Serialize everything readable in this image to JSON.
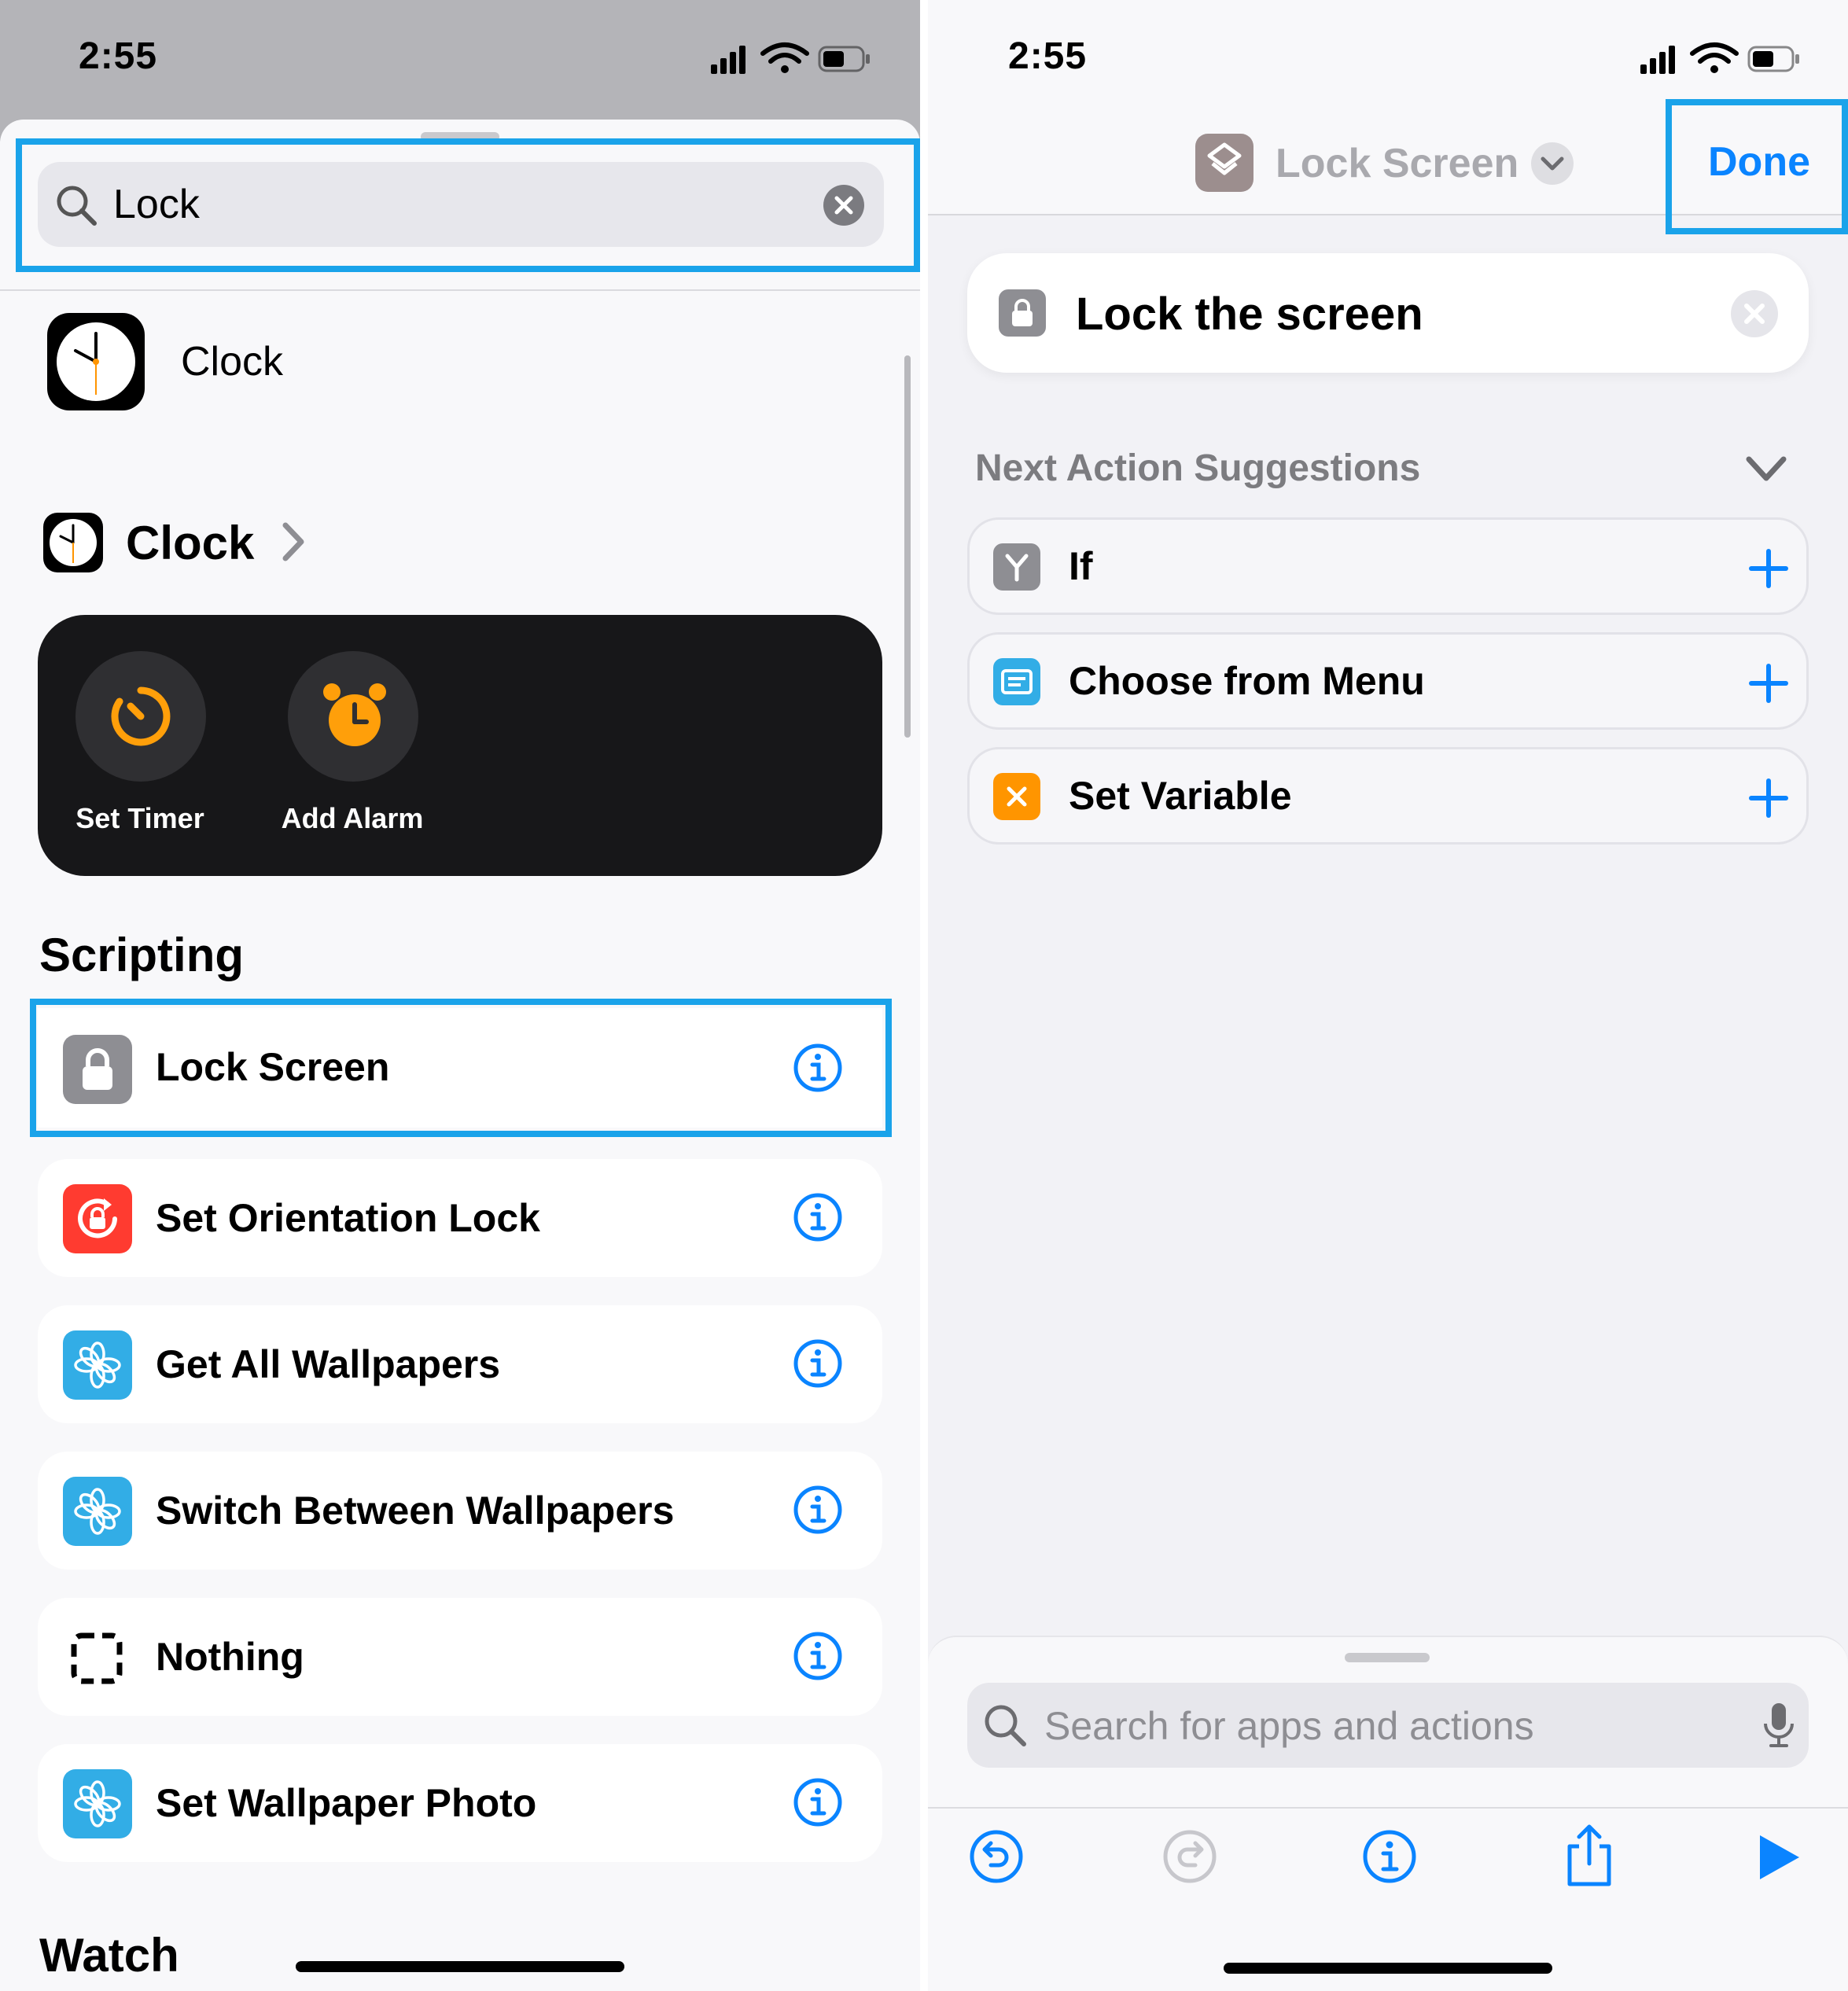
{
  "left": {
    "status_time": "2:55",
    "search": {
      "value": "Lock"
    },
    "top_result": {
      "label": "Clock"
    },
    "app_section": {
      "title": "Clock"
    },
    "quick_actions": [
      {
        "label": "Set Timer",
        "icon": "timer-icon",
        "color": "#ff9f0a"
      },
      {
        "label": "Add Alarm",
        "icon": "alarm-clock-icon",
        "color": "#ff9f0a"
      }
    ],
    "section_scripting": "Scripting",
    "actions": [
      {
        "label": "Lock Screen",
        "icon": "lock-icon",
        "color": "#8e8e93"
      },
      {
        "label": "Set Orientation Lock",
        "icon": "orientation-lock-icon",
        "color": "#ff3b30"
      },
      {
        "label": "Get All Wallpapers",
        "icon": "wallpaper-flower-icon",
        "color": "#32ade6"
      },
      {
        "label": "Switch Between Wallpapers",
        "icon": "wallpaper-flower-icon",
        "color": "#32ade6"
      },
      {
        "label": "Nothing",
        "icon": "dashed-square-icon",
        "color": "#000000"
      },
      {
        "label": "Set Wallpaper Photo",
        "icon": "wallpaper-flower-icon",
        "color": "#32ade6"
      }
    ],
    "section_watch": "Watch"
  },
  "right": {
    "status_time": "2:55",
    "shortcut_title": "Lock Screen",
    "done_label": "Done",
    "action_card": {
      "label": "Lock the screen",
      "icon": "lock-icon"
    },
    "suggestions_title": "Next Action Suggestions",
    "suggestions": [
      {
        "label": "If",
        "icon": "branch-icon",
        "color": "#8e8e93"
      },
      {
        "label": "Choose from Menu",
        "icon": "menu-icon",
        "color": "#32ade6"
      },
      {
        "label": "Set Variable",
        "icon": "variable-icon",
        "color": "#ff9500"
      }
    ],
    "search_placeholder": "Search for apps and actions"
  },
  "colors": {
    "accent": "#0a84ff",
    "highlight": "#1aa3ea"
  }
}
